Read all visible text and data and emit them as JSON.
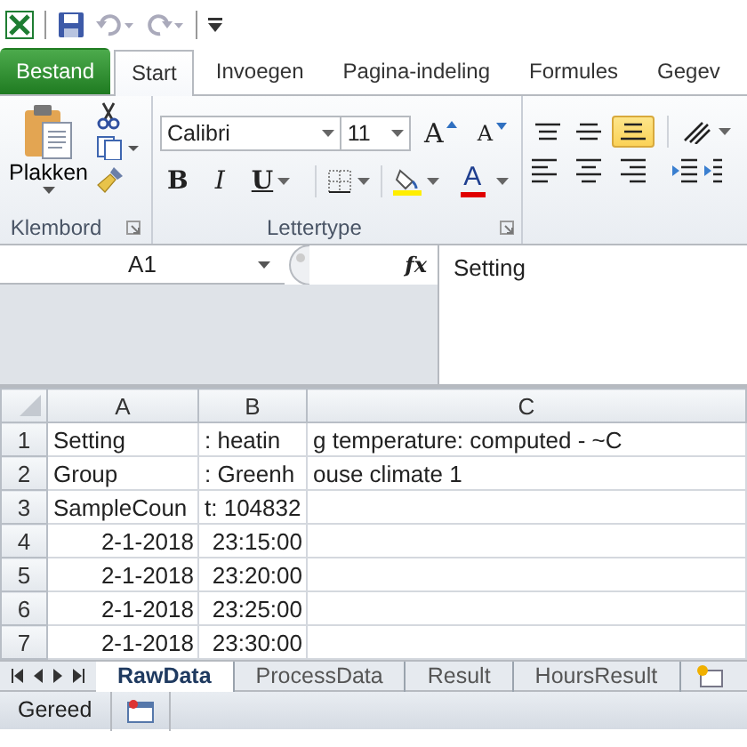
{
  "ribbon_tabs": [
    {
      "label": "Bestand",
      "kind": "file",
      "selected": false
    },
    {
      "label": "Start",
      "kind": "tab",
      "selected": true
    },
    {
      "label": "Invoegen",
      "kind": "tab",
      "selected": false
    },
    {
      "label": "Pagina-indeling",
      "kind": "tab",
      "selected": false
    },
    {
      "label": "Formules",
      "kind": "tab",
      "selected": false
    },
    {
      "label": "Gegev",
      "kind": "tab",
      "selected": false
    }
  ],
  "clipboard": {
    "paste_label": "Plakken",
    "group_label": "Klembord"
  },
  "font": {
    "font_name": "Calibri",
    "font_size": "11",
    "grow_label": "A",
    "shrink_label": "A",
    "group_label": "Lettertype",
    "style_buttons": [
      {
        "label": "B",
        "kind": "bold"
      },
      {
        "label": "I",
        "kind": "italic"
      },
      {
        "label": "U",
        "kind": "underline"
      }
    ],
    "color_label": "A"
  },
  "alignment": {
    "vertical_buttons": [
      {
        "kind": "top",
        "selected": false
      },
      {
        "kind": "middle",
        "selected": false
      },
      {
        "kind": "bottom",
        "selected": true
      }
    ]
  },
  "formula_bar": {
    "name_box": "A1",
    "function_label": "fx",
    "content": "Setting"
  },
  "grid": {
    "columns": [
      "A",
      "B",
      "C"
    ],
    "rows": [
      {
        "number": "1",
        "kind": "text",
        "cells": [
          "Setting",
          ": heatin",
          "g temperature: computed - ~C"
        ]
      },
      {
        "number": "2",
        "kind": "text",
        "cells": [
          "Group",
          ": Greenh",
          "ouse climate 1"
        ]
      },
      {
        "number": "3",
        "kind": "text",
        "cells": [
          "SampleCoun",
          "t: 104832",
          ""
        ]
      },
      {
        "number": "4",
        "kind": "datetime",
        "cells": [
          "2-1-2018",
          "23:15:00",
          ""
        ]
      },
      {
        "number": "5",
        "kind": "datetime",
        "cells": [
          "2-1-2018",
          "23:20:00",
          ""
        ]
      },
      {
        "number": "6",
        "kind": "datetime",
        "cells": [
          "2-1-2018",
          "23:25:00",
          ""
        ]
      },
      {
        "number": "7",
        "kind": "datetime",
        "cells": [
          "2-1-2018",
          "23:30:00",
          ""
        ]
      }
    ]
  },
  "sheet_tabs": [
    {
      "label": "RawData",
      "selected": true
    },
    {
      "label": "ProcessData",
      "selected": false
    },
    {
      "label": "Result",
      "selected": false
    },
    {
      "label": "HoursResult",
      "selected": false
    }
  ],
  "status_bar": {
    "text": "Gereed"
  }
}
